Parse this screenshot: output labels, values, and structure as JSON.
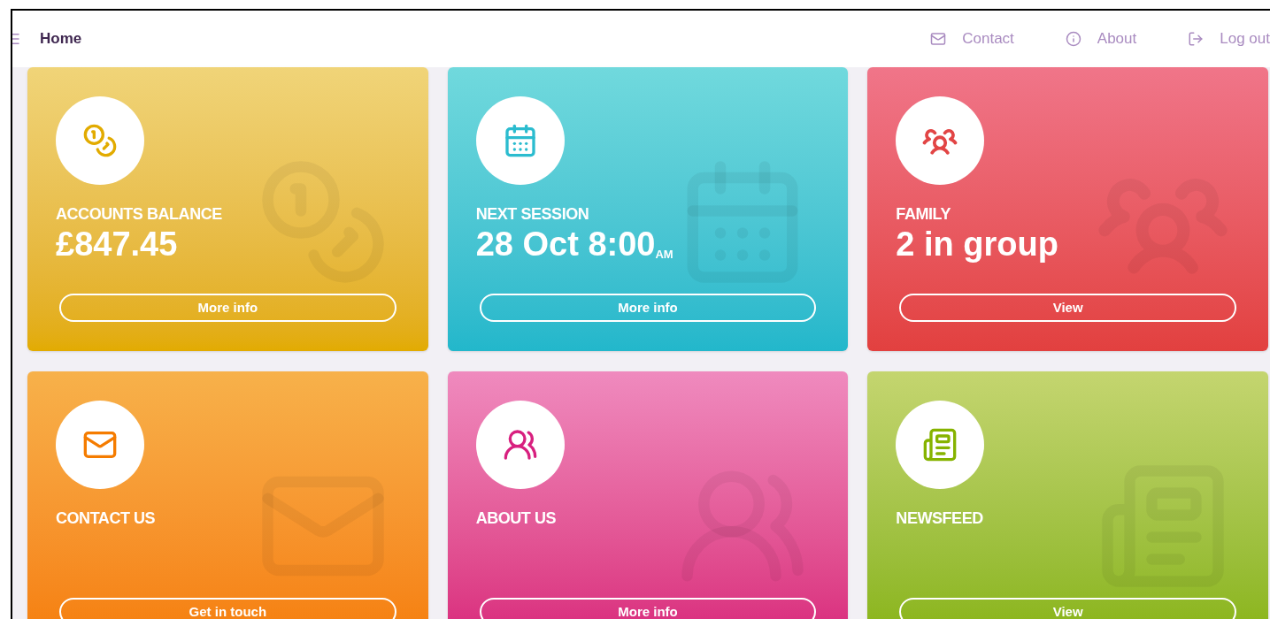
{
  "navbar": {
    "title": "Home",
    "links": [
      {
        "kind": "mail",
        "label": "Contact"
      },
      {
        "kind": "info",
        "label": "About"
      },
      {
        "kind": "logout",
        "label": "Log out"
      }
    ]
  },
  "cards": [
    {
      "kind": "balance",
      "label": "ACCOUNTS BALANCE",
      "value": "£847.45",
      "button": "More info"
    },
    {
      "kind": "session",
      "label": "NEXT SESSION",
      "value": "28 Oct 8:00$_{AM}$",
      "button": "More info"
    },
    {
      "kind": "family",
      "label": "FAMILY",
      "value": "2 in group",
      "button": "View"
    },
    {
      "kind": "contact",
      "label": "CONTACT US",
      "button": "Get in touch"
    },
    {
      "kind": "about",
      "label": "ABOUT US",
      "button": "More info"
    },
    {
      "kind": "news",
      "label": "NEWSFEED",
      "button": "View"
    }
  ]
}
